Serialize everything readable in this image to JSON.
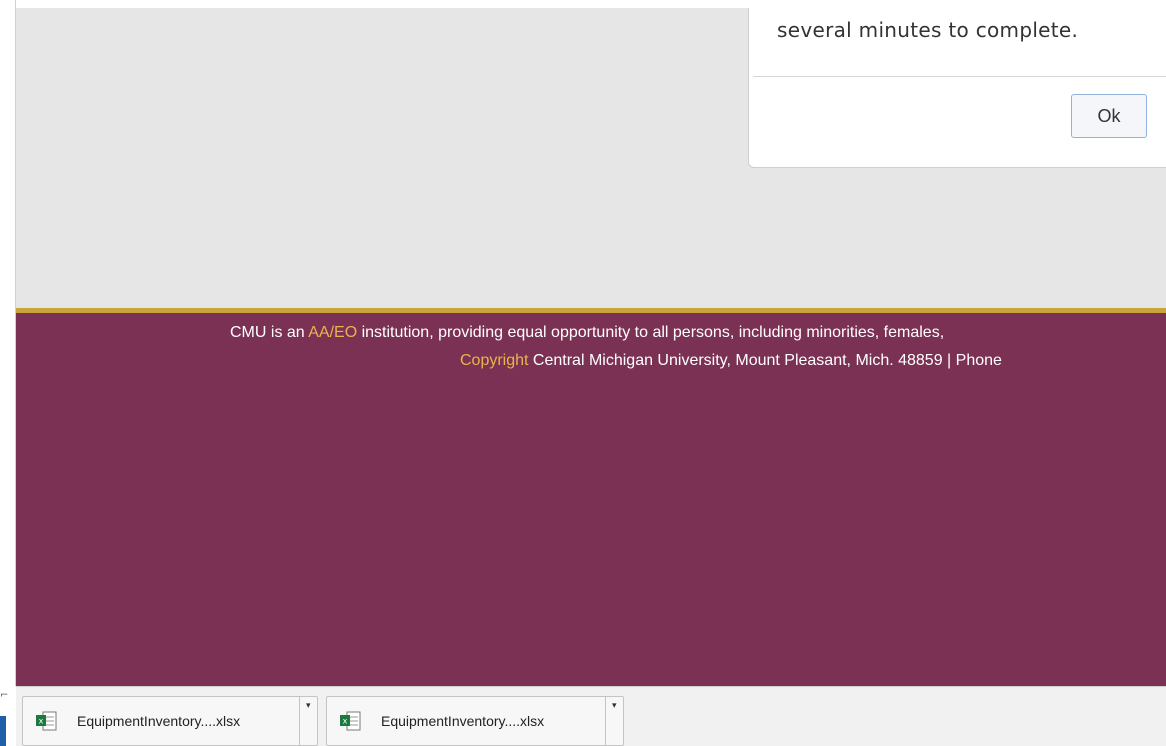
{
  "modal": {
    "message": "several minutes to complete.",
    "ok_label": "Ok"
  },
  "footer": {
    "line1_prefix": "CMU is an ",
    "line1_link": "AA/EO",
    "line1_suffix": " institution, providing equal opportunity to all persons, including minorities, females,",
    "line2_link": "Copyright",
    "line2_suffix": " Central Michigan University, Mount Pleasant, Mich. 48859 | Phone",
    "background_color": "#7b3154",
    "accent_color": "#c9a43a",
    "link_color": "#e9b44c"
  },
  "downloads": {
    "items": [
      {
        "file_name": "EquipmentInventory....xlsx",
        "icon": "excel-file-icon"
      },
      {
        "file_name": "EquipmentInventory....xlsx",
        "icon": "excel-file-icon"
      }
    ]
  }
}
